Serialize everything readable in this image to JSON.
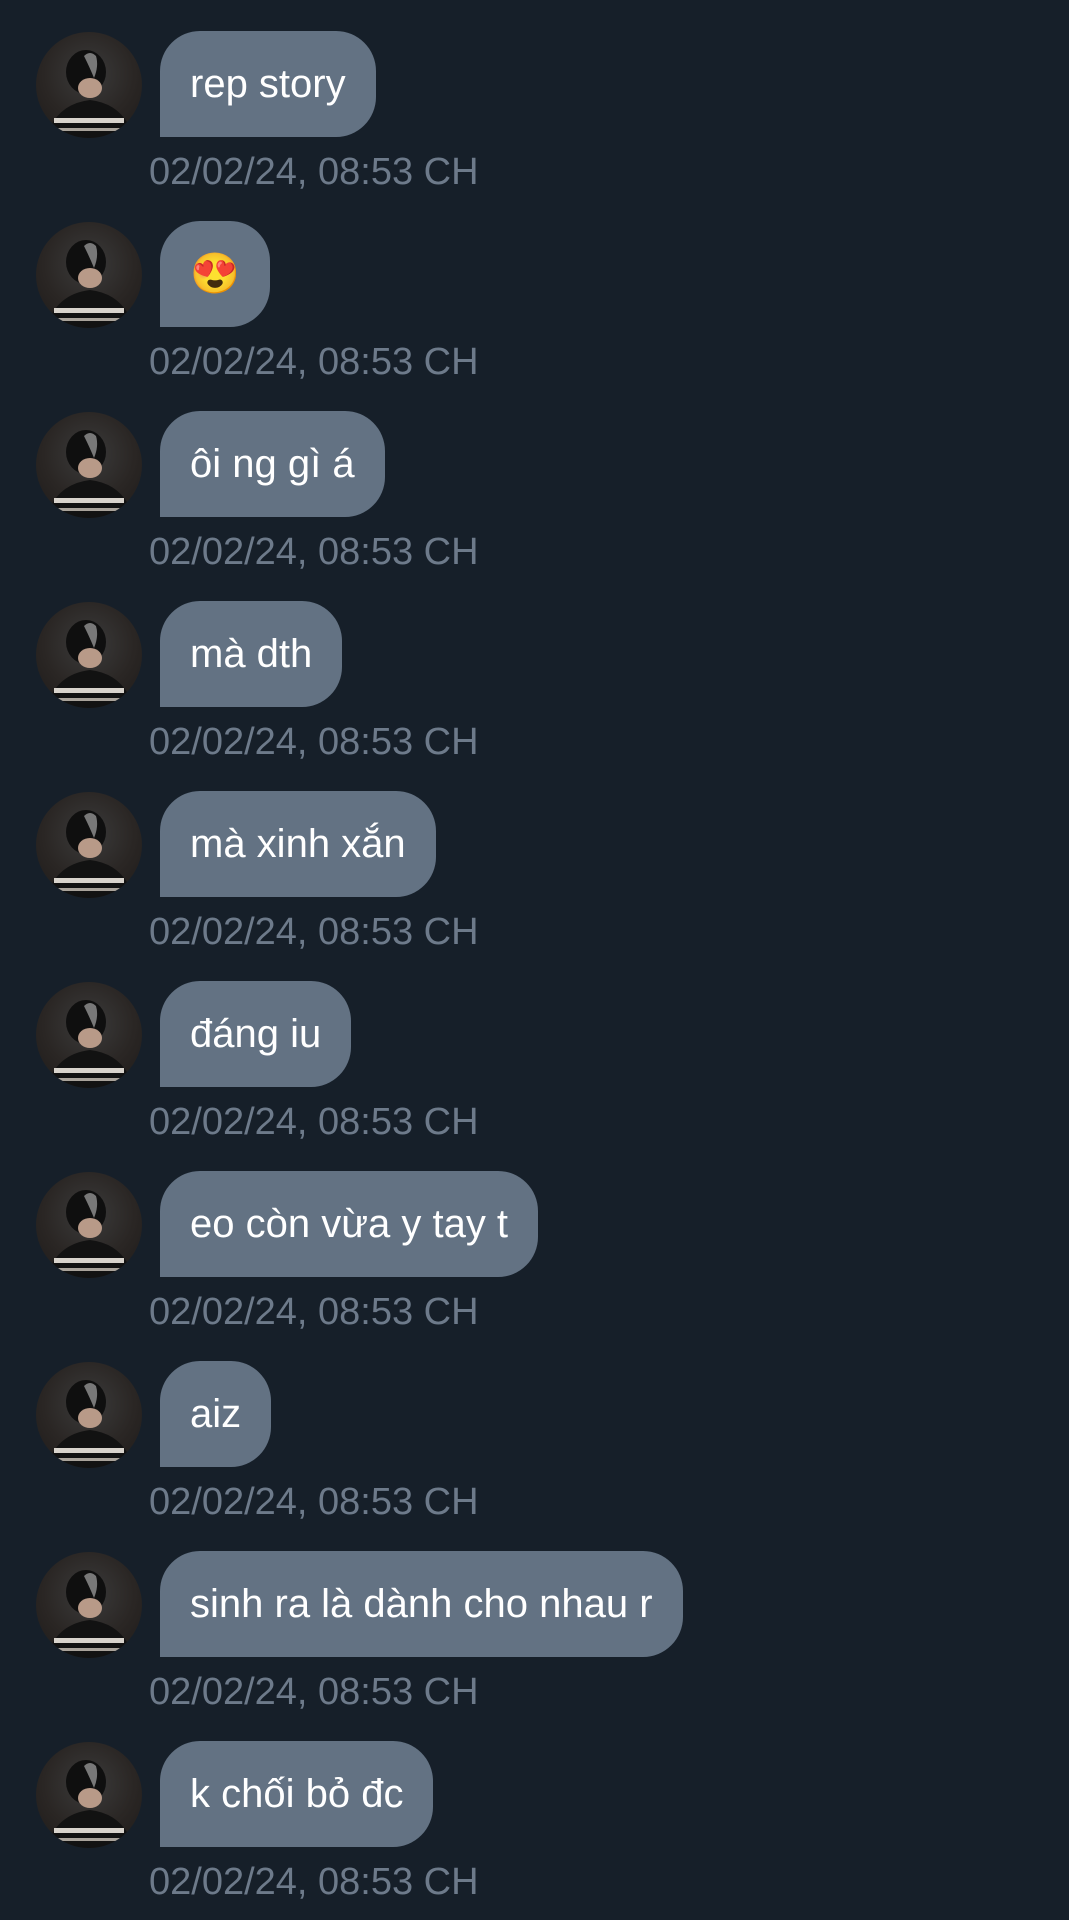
{
  "colors": {
    "background": "#161f29",
    "bubble": "#637283",
    "bubble_text": "#ffffff",
    "timestamp": "#6d7a8a"
  },
  "messages": [
    {
      "text": "rep story",
      "time": "02/02/24, 08:53 CH",
      "avatar": "user-avatar"
    },
    {
      "text": "😍",
      "time": "02/02/24, 08:53 CH",
      "avatar": "user-avatar"
    },
    {
      "text": "ôi ng gì á",
      "time": "02/02/24, 08:53 CH",
      "avatar": "user-avatar"
    },
    {
      "text": "mà dth",
      "time": "02/02/24, 08:53 CH",
      "avatar": "user-avatar"
    },
    {
      "text": "mà xinh xắn",
      "time": "02/02/24, 08:53 CH",
      "avatar": "user-avatar"
    },
    {
      "text": "đáng iu",
      "time": "02/02/24, 08:53 CH",
      "avatar": "user-avatar"
    },
    {
      "text": "eo còn vừa y tay t",
      "time": "02/02/24, 08:53 CH",
      "avatar": "user-avatar"
    },
    {
      "text": "aiz",
      "time": "02/02/24, 08:53 CH",
      "avatar": "user-avatar"
    },
    {
      "text": "sinh ra là dành cho nhau r",
      "time": "02/02/24, 08:53 CH",
      "avatar": "user-avatar"
    },
    {
      "text": "k chối bỏ đc",
      "time": "02/02/24, 08:53 CH",
      "avatar": "user-avatar"
    }
  ]
}
